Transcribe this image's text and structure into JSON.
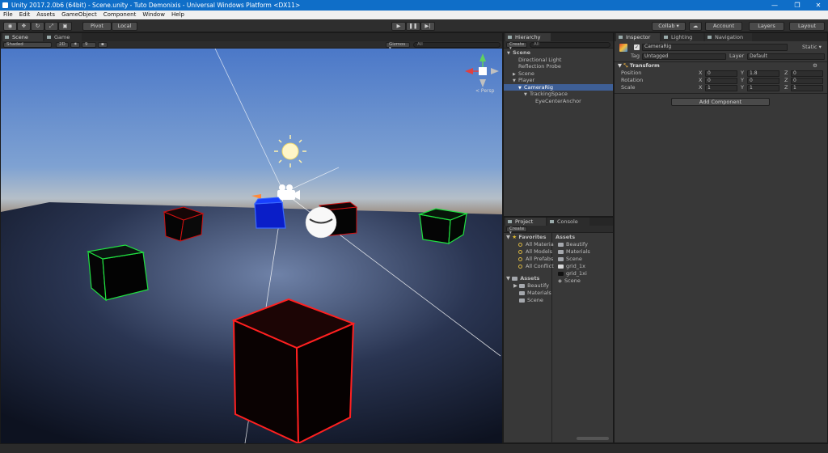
{
  "window": {
    "title": "Unity 2017.2.0b6 (64bit) - Scene.unity - Tuto Demonixis - Universal Windows Platform <DX11>",
    "minimize": "—",
    "maximize": "❐",
    "close": "✕"
  },
  "menu": [
    "File",
    "Edit",
    "Assets",
    "GameObject",
    "Component",
    "Window",
    "Help"
  ],
  "toolbar": {
    "pivot": "Pivot",
    "local": "Local",
    "collab": "Collab ▾",
    "account": "Account",
    "layers": "Layers",
    "layout": "Layout"
  },
  "scene_panel": {
    "tab_scene": "Scene",
    "tab_game": "Game",
    "shading": "Shaded",
    "mode_2d": "2D",
    "fx_count": "9",
    "gizmos": "Gizmos ▾",
    "all": "All",
    "persp": "< Persp"
  },
  "hierarchy": {
    "tab": "Hierarchy",
    "create": "Create ▾",
    "search": "All",
    "rows": [
      {
        "label": "Scene",
        "indent": 0,
        "arrow": "▼",
        "bold": true,
        "selected": false
      },
      {
        "label": "Directional Light",
        "indent": 1,
        "arrow": "",
        "bold": false,
        "selected": false
      },
      {
        "label": "Reflection Probe",
        "indent": 1,
        "arrow": "",
        "bold": false,
        "selected": false
      },
      {
        "label": "Scene",
        "indent": 1,
        "arrow": "▶",
        "bold": false,
        "selected": false
      },
      {
        "label": "Player",
        "indent": 1,
        "arrow": "▼",
        "bold": false,
        "selected": false
      },
      {
        "label": "CameraRig",
        "indent": 2,
        "arrow": "▼",
        "bold": false,
        "selected": true
      },
      {
        "label": "TrackingSpace",
        "indent": 3,
        "arrow": "▼",
        "bold": false,
        "selected": false
      },
      {
        "label": "EyeCenterAnchor",
        "indent": 4,
        "arrow": "",
        "bold": false,
        "selected": false
      }
    ]
  },
  "inspector": {
    "tab_inspector": "Inspector",
    "tab_lighting": "Lighting",
    "tab_navigation": "Navigation",
    "object_name": "CameraRig",
    "static": "Static ▾",
    "tag_label": "Tag",
    "tag_value": "Untagged",
    "layer_label": "Layer",
    "layer_value": "Default",
    "component": "Transform",
    "transform": [
      {
        "label": "Position",
        "x": "0",
        "y": "1.8",
        "z": "0"
      },
      {
        "label": "Rotation",
        "x": "0",
        "y": "0",
        "z": "0"
      },
      {
        "label": "Scale",
        "x": "1",
        "y": "1",
        "z": "1"
      }
    ],
    "add_component": "Add Component"
  },
  "project": {
    "tab_project": "Project",
    "tab_console": "Console",
    "create": "Create ▾",
    "favorites_header": "Favorites",
    "favorites": [
      "All Materia",
      "All Models",
      "All Prefabs",
      "All Conflict"
    ],
    "assets_header": "Assets",
    "assets_tree": [
      "Beautify",
      "Materials",
      "Scene"
    ],
    "assets_list_header": "Assets",
    "assets_list": [
      "Beautify",
      "Materials",
      "Scene",
      "grid_1x",
      "grid_1xi",
      "Scene"
    ]
  },
  "colors": {
    "titlebar": "#0f6ec8",
    "selection": "#3e5f96",
    "panel": "#383838"
  }
}
